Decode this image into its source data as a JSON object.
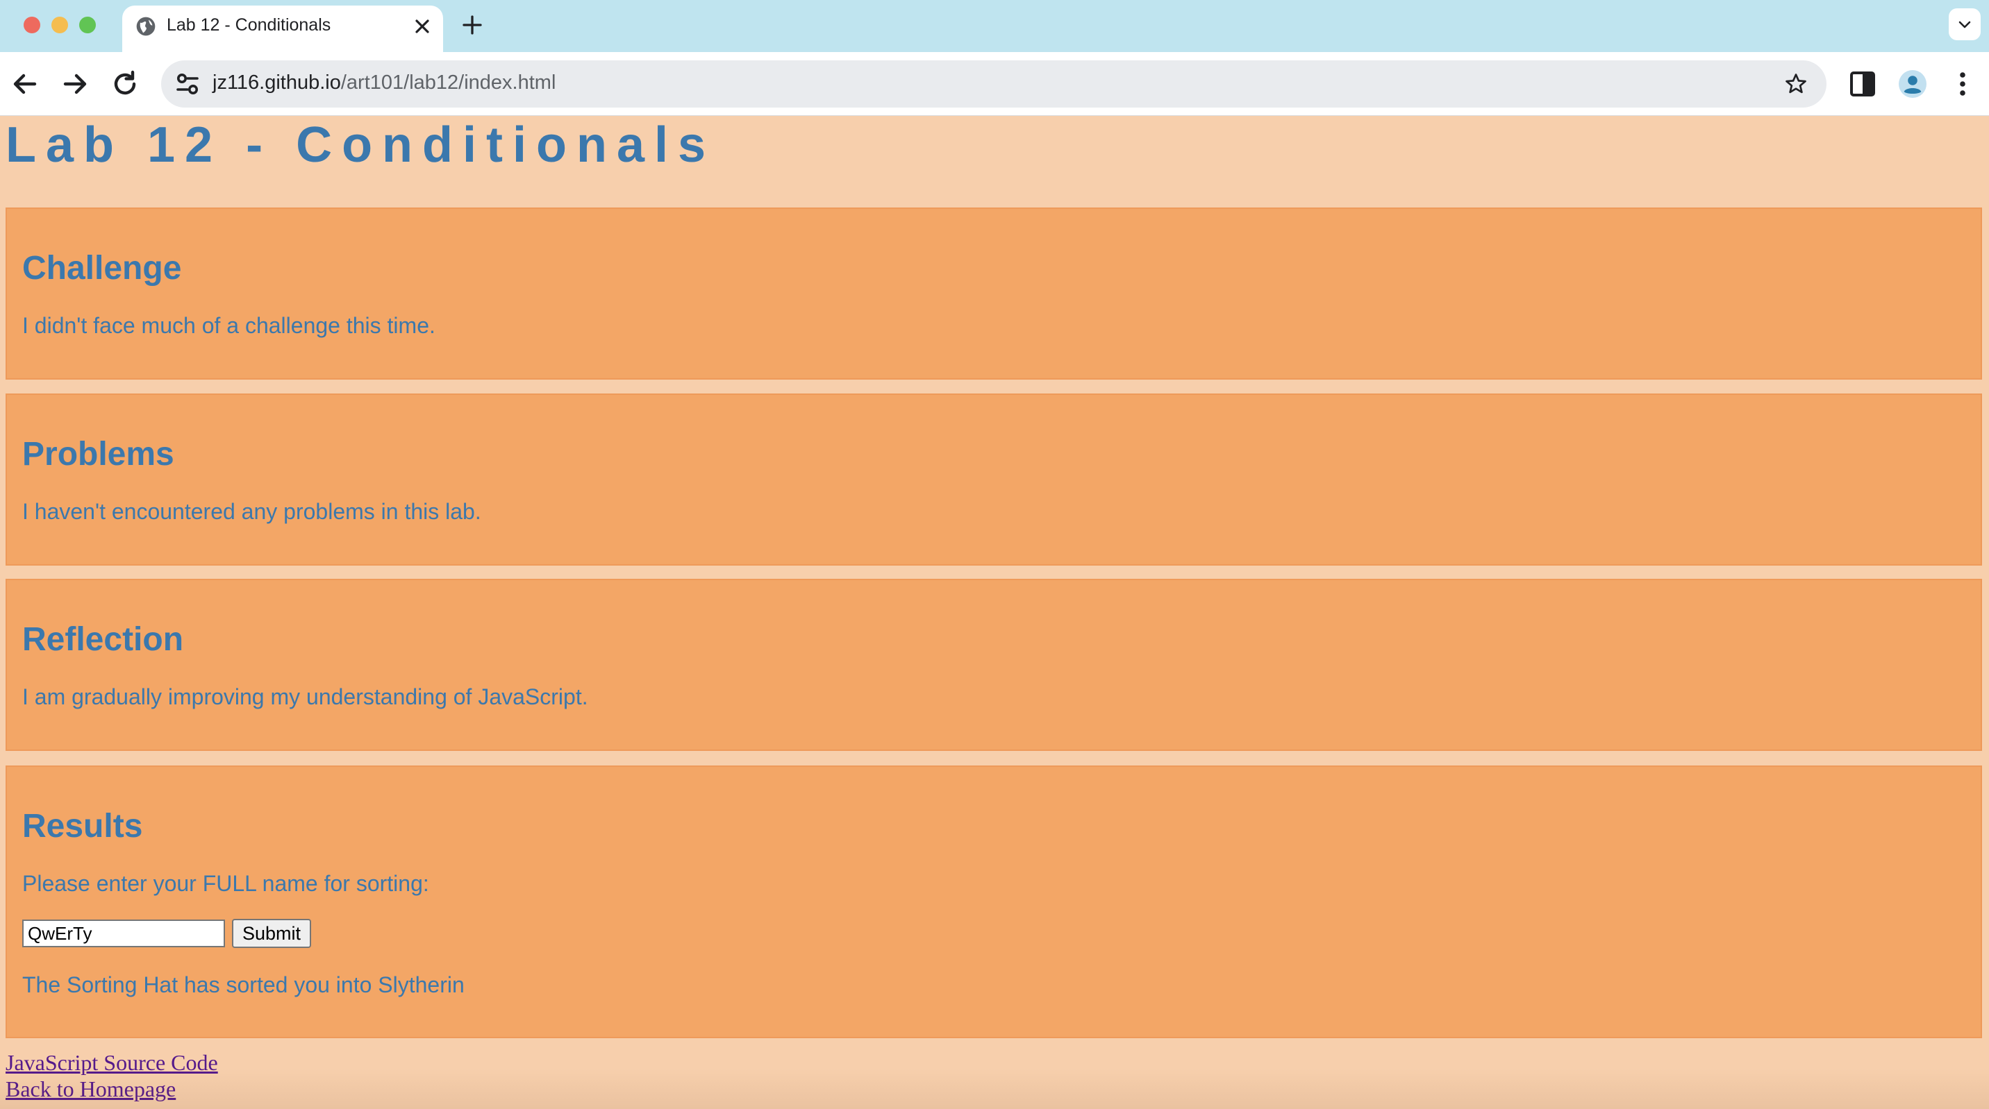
{
  "browser": {
    "tab": {
      "title": "Lab 12 - Conditionals",
      "favicon": "globe-icon",
      "close_icon": "close-icon"
    },
    "new_tab_icon": "plus-icon",
    "tab_list_icon": "chevron-down-icon",
    "nav": {
      "back_icon": "arrow-left-icon",
      "forward_icon": "arrow-right-icon",
      "reload_icon": "reload-icon"
    },
    "address_bar": {
      "domain": "jz116.github.io",
      "path": "/art101/lab12/index.html",
      "site_info_icon": "tune-icon",
      "bookmark_icon": "star-icon"
    },
    "toolbar_icons": [
      "side-panel-icon",
      "profile-avatar-icon",
      "kebab-menu-icon"
    ]
  },
  "page": {
    "title": "Lab 12 - Conditionals",
    "sections": [
      {
        "heading": "Challenge",
        "text": "I didn't face much of a challenge this time."
      },
      {
        "heading": "Problems",
        "text": "I haven't encountered any problems in this lab."
      },
      {
        "heading": "Reflection",
        "text": "I am gradually improving my understanding of JavaScript."
      }
    ],
    "results": {
      "heading": "Results",
      "prompt": "Please enter your FULL name for sorting:",
      "input_value": "QwErTy",
      "submit_label": "Submit",
      "output": "The Sorting Hat has sorted you into Slytherin"
    },
    "links": {
      "source": "JavaScript Source Code",
      "home": "Back to Homepage"
    }
  },
  "colors": {
    "page_background": "#f7cfac",
    "section_background": "#f3a666",
    "text_accent": "#3b78ad",
    "tabstrip": "#bfe4ef",
    "visited_link": "#551a8b"
  }
}
